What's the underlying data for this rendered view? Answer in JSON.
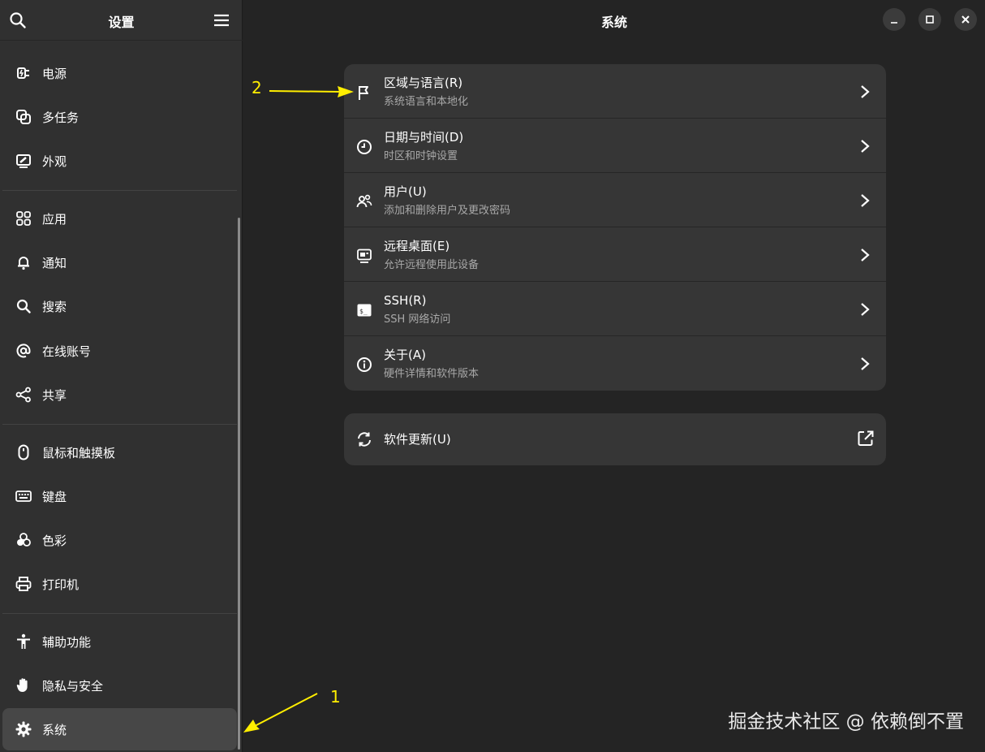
{
  "sidebar": {
    "title": "设置",
    "items": [
      {
        "label": "电源",
        "icon": "power-plug-icon"
      },
      {
        "label": "多任务",
        "icon": "multitasking-icon"
      },
      {
        "label": "外观",
        "icon": "appearance-icon"
      },
      {
        "label": "应用",
        "icon": "apps-grid-icon"
      },
      {
        "label": "通知",
        "icon": "bell-icon"
      },
      {
        "label": "搜索",
        "icon": "search-icon"
      },
      {
        "label": "在线账号",
        "icon": "at-sign-icon"
      },
      {
        "label": "共享",
        "icon": "share-icon"
      },
      {
        "label": "鼠标和触摸板",
        "icon": "mouse-icon"
      },
      {
        "label": "键盘",
        "icon": "keyboard-icon"
      },
      {
        "label": "色彩",
        "icon": "color-icon"
      },
      {
        "label": "打印机",
        "icon": "printer-icon"
      },
      {
        "label": "辅助功能",
        "icon": "accessibility-icon"
      },
      {
        "label": "隐私与安全",
        "icon": "hand-icon"
      },
      {
        "label": "系统",
        "icon": "gear-icon"
      }
    ],
    "selected": "系统"
  },
  "main": {
    "title": "系统",
    "group1": [
      {
        "title": "区域与语言(R)",
        "subtitle": "系统语言和本地化",
        "icon": "flag-icon"
      },
      {
        "title": "日期与时间(D)",
        "subtitle": "时区和时钟设置",
        "icon": "clock-icon"
      },
      {
        "title": "用户(U)",
        "subtitle": "添加和删除用户及更改密码",
        "icon": "users-icon"
      },
      {
        "title": "远程桌面(E)",
        "subtitle": "允许远程使用此设备",
        "icon": "remote-desktop-icon"
      },
      {
        "title": "SSH(R)",
        "subtitle": "SSH 网络访问",
        "icon": "terminal-icon"
      },
      {
        "title": "关于(A)",
        "subtitle": "硬件详情和软件版本",
        "icon": "info-icon"
      }
    ],
    "group2": [
      {
        "title": "软件更新(U)",
        "icon": "refresh-icon",
        "trailing_icon": "external-link-icon"
      }
    ]
  },
  "annotations": {
    "one": "1",
    "two": "2",
    "color": "#ffee00"
  },
  "watermark": "掘金技术社区 @ 依赖倒不置",
  "colors": {
    "background": "#242424",
    "sidebar": "#303030",
    "card": "#363636",
    "selected": "#474747"
  }
}
